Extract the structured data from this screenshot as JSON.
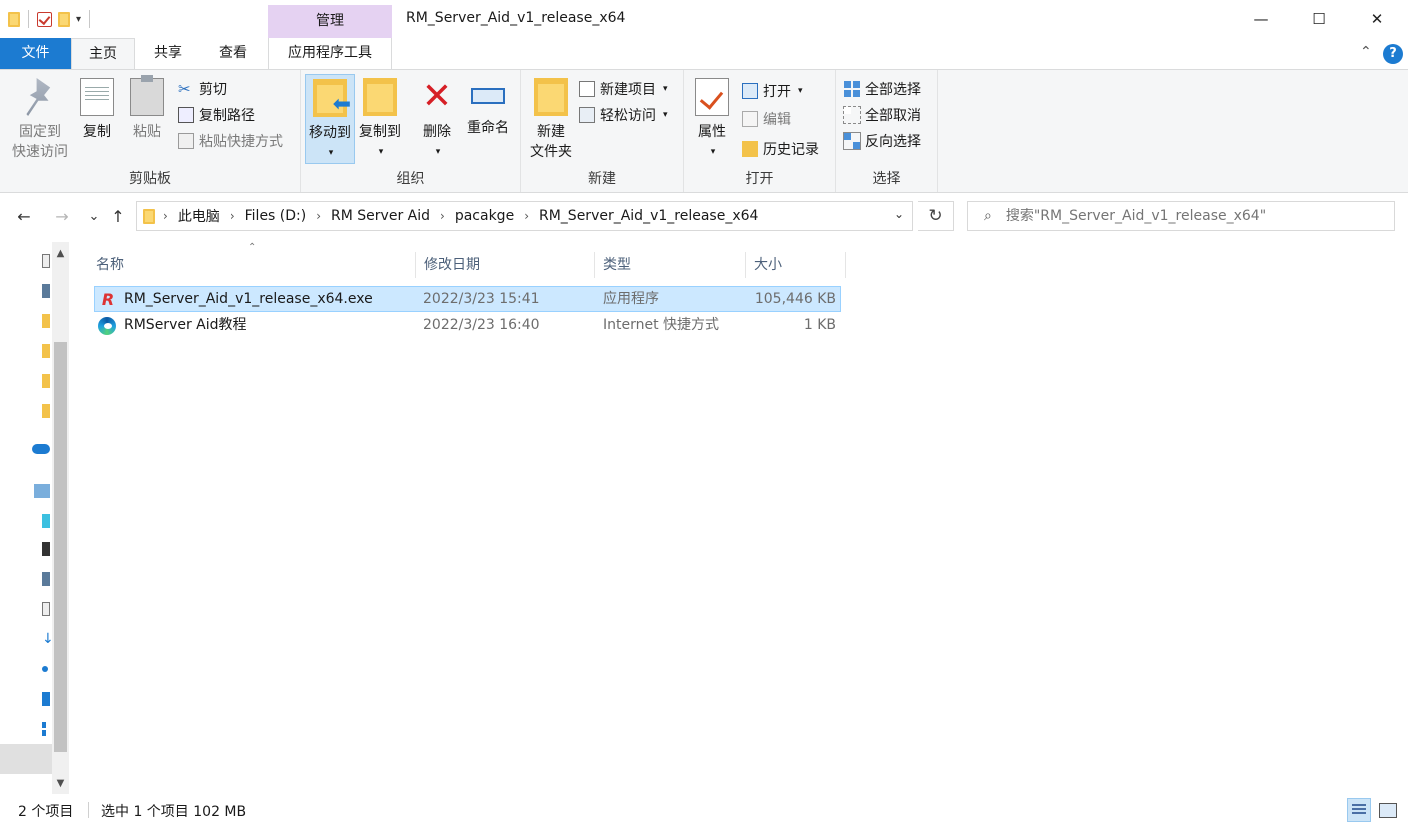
{
  "window": {
    "title": "RM_Server_Aid_v1_release_x64",
    "context_tab_header": "管理",
    "controls": {
      "minimize": "—",
      "maximize": "☐",
      "close": "✕"
    }
  },
  "quick_access": {
    "dropdown": "▾"
  },
  "tabs": {
    "file": "文件",
    "home": "主页",
    "share": "共享",
    "view": "查看",
    "app_tools": "应用程序工具",
    "collapse": "⌃",
    "help": "?"
  },
  "ribbon": {
    "clipboard": {
      "label": "剪贴板",
      "pin_quick_access": "固定到\n快速访问",
      "pin_line1": "固定到",
      "pin_line2": "快速访问",
      "copy": "复制",
      "paste": "粘贴",
      "cut": "剪切",
      "copy_path": "复制路径",
      "paste_shortcut": "粘贴快捷方式"
    },
    "organize": {
      "label": "组织",
      "move_to": "移动到",
      "copy_to": "复制到",
      "delete": "删除",
      "rename": "重命名"
    },
    "new": {
      "label": "新建",
      "new_folder_line1": "新建",
      "new_folder_line2": "文件夹",
      "new_item": "新建项目",
      "easy_access": "轻松访问"
    },
    "open": {
      "label": "打开",
      "properties": "属性",
      "open": "打开",
      "edit": "编辑",
      "history": "历史记录"
    },
    "select": {
      "label": "选择",
      "select_all": "全部选择",
      "select_none": "全部取消",
      "invert": "反向选择"
    }
  },
  "navigation": {
    "back": "←",
    "forward": "→",
    "recent": "⌄",
    "up": "↑",
    "breadcrumbs": [
      "此电脑",
      "Files (D:)",
      "RM Server Aid",
      "pacakge",
      "RM_Server_Aid_v1_release_x64"
    ],
    "refresh": "↻",
    "search_placeholder": "搜索\"RM_Server_Aid_v1_release_x64\""
  },
  "columns": {
    "name": "名称",
    "date": "修改日期",
    "type": "类型",
    "size": "大小"
  },
  "files": [
    {
      "name": "RM_Server_Aid_v1_release_x64.exe",
      "date": "2022/3/23 15:41",
      "type": "应用程序",
      "size": "105,446 KB",
      "selected": true,
      "icon": "app-exe-icon"
    },
    {
      "name": "RMServer Aid教程",
      "date": "2022/3/23 16:40",
      "type": "Internet 快捷方式",
      "size": "1 KB",
      "selected": false,
      "icon": "edge-shortcut-icon"
    }
  ],
  "status": {
    "item_count": "2 个项目",
    "selection": "选中 1 个项目  102 MB"
  },
  "colors": {
    "accent": "#1c7bd1",
    "context_tab": "#e5d2f2",
    "selection_bg": "#cce8ff",
    "ribbon_bg": "#f5f6f7"
  }
}
